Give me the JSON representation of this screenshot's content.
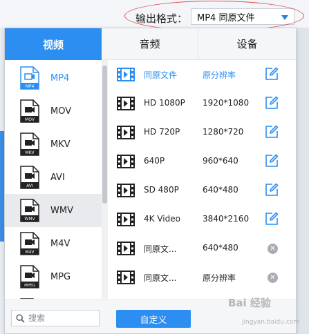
{
  "output_format": {
    "label": "输出格式：",
    "value": "MP4  同原文件"
  },
  "tabs": [
    {
      "label": "视频",
      "active": true
    },
    {
      "label": "音频",
      "active": false
    },
    {
      "label": "设备",
      "active": false
    }
  ],
  "formats": [
    {
      "label": "MP4",
      "badge": "MP4",
      "selected": true
    },
    {
      "label": "MOV",
      "badge": "MOV",
      "selected": false
    },
    {
      "label": "MKV",
      "badge": "MKV",
      "selected": false
    },
    {
      "label": "AVI",
      "badge": "AVI",
      "selected": false
    },
    {
      "label": "WMV",
      "badge": "WMV",
      "selected": false,
      "hover": true
    },
    {
      "label": "M4V",
      "badge": "M4V",
      "selected": false
    },
    {
      "label": "MPG",
      "badge": "MPEG",
      "selected": false
    }
  ],
  "presets": [
    {
      "name": "同原文件",
      "resolution": "原分辨率",
      "action": "edit",
      "selected": true
    },
    {
      "name": "HD 1080P",
      "resolution": "1920*1080",
      "action": "edit"
    },
    {
      "name": "HD 720P",
      "resolution": "1280*720",
      "action": "edit"
    },
    {
      "name": "640P",
      "resolution": "960*640",
      "action": "edit"
    },
    {
      "name": "SD 480P",
      "resolution": "640*480",
      "action": "edit"
    },
    {
      "name": "4K Video",
      "resolution": "3840*2160",
      "action": "edit"
    },
    {
      "name": "同原文...",
      "resolution": "640*480",
      "action": "delete"
    },
    {
      "name": "同原文...",
      "resolution": "原分辨率",
      "action": "delete"
    }
  ],
  "search": {
    "placeholder": "搜索"
  },
  "custom_button": {
    "label": "自定义"
  },
  "watermark": {
    "text": "Bai 经验",
    "sub": "jingyan.baidu.com"
  },
  "colors": {
    "accent": "#2b8ef0",
    "annotation": "#d9534f",
    "delete_gray": "#a9adb3"
  }
}
